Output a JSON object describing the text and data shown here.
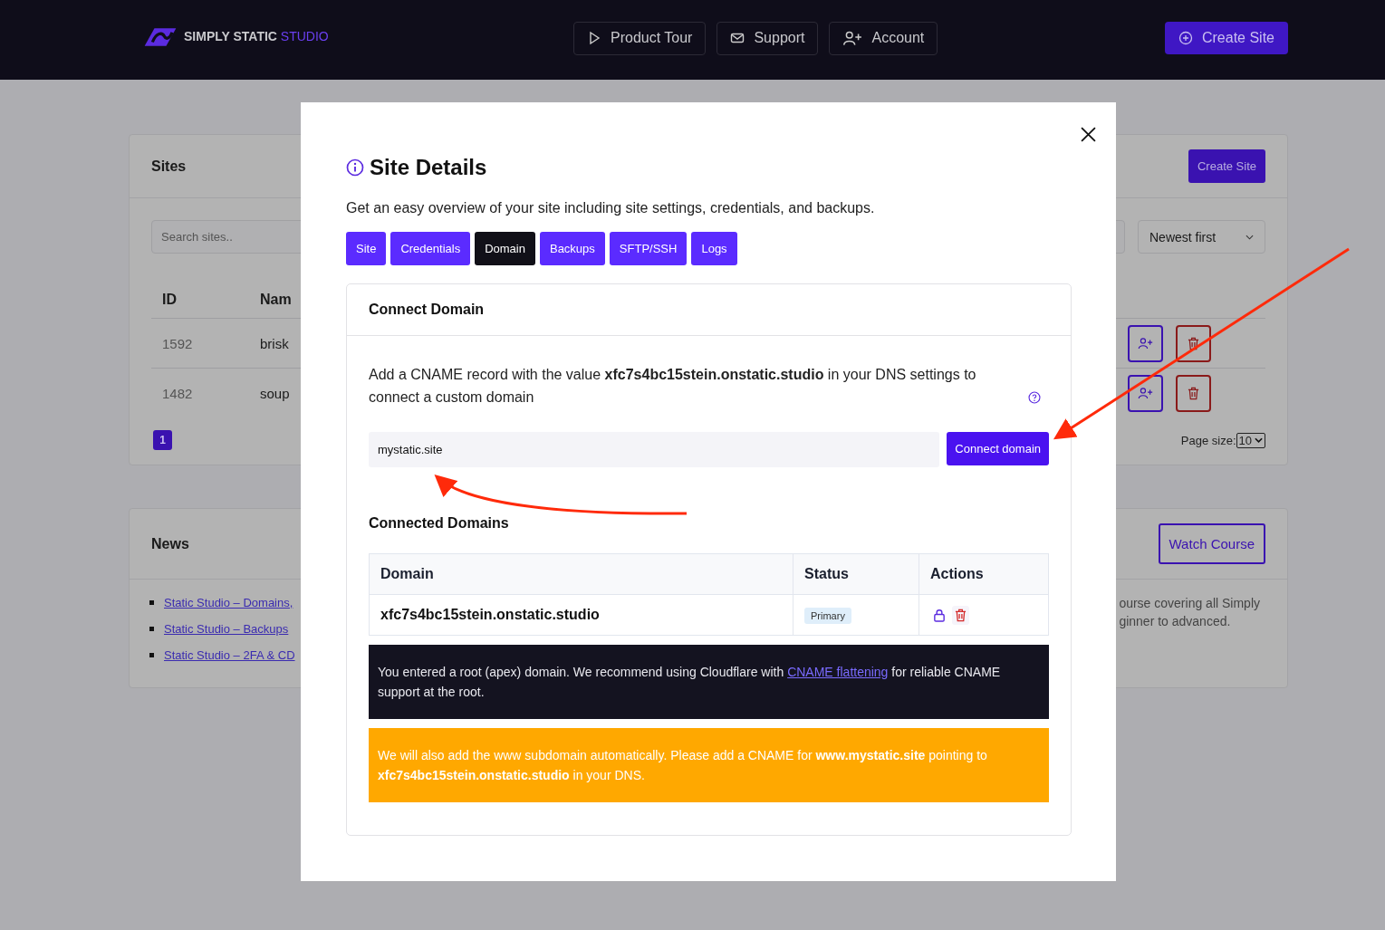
{
  "header": {
    "logo": {
      "main": "SIMPLY STATIC",
      "accent": "STUDIO"
    },
    "nav": [
      {
        "kind": "tour",
        "label": "Product Tour"
      },
      {
        "kind": "support",
        "label": "Support"
      },
      {
        "kind": "account",
        "label": "Account"
      }
    ],
    "create_button": "Create Site"
  },
  "sites_card": {
    "title": "Sites",
    "create_button": "Create Site",
    "search": {
      "placeholder": "Search sites.."
    },
    "sort": "Newest first",
    "columns": [
      "ID",
      "Nam"
    ],
    "rows": [
      {
        "id": "1592",
        "name": "brisk"
      },
      {
        "id": "1482",
        "name": "soup"
      }
    ],
    "pages": [
      {
        "label": "1",
        "selected": true
      }
    ],
    "page_size_label": "Page size:",
    "page_size": "10"
  },
  "news_card": {
    "title": "News",
    "links": [
      "Static Studio – Domains,",
      "Static Studio – Backups",
      "Static Studio – 2FA & CD"
    ],
    "watch_button": "Watch Course",
    "description": [
      "ourse covering all Simply",
      "ginner to advanced."
    ]
  },
  "modal": {
    "title": "Site Details",
    "description": "Get an easy overview of your site including site settings, credentials, and backups.",
    "tabs": [
      {
        "label": "Site",
        "selected": false
      },
      {
        "label": "Credentials",
        "selected": false
      },
      {
        "label": "Domain",
        "selected": true
      },
      {
        "label": "Backups",
        "selected": false
      },
      {
        "label": "SFTP/SSH",
        "selected": false
      },
      {
        "label": "Logs",
        "selected": false
      }
    ],
    "connect": {
      "title": "Connect Domain",
      "instruction": "Add a CNAME record with the value **xfc7s4bc15stein.onstatic.studio** in your DNS settings to connect a custom domain",
      "input": {
        "value": "mystatic.site"
      },
      "button": "Connect domain"
    },
    "connected_title": "Connected Domains",
    "table": {
      "columns": [
        "Domain",
        "Status",
        "Actions"
      ],
      "rows": [
        {
          "domain": "xfc7s4bc15stein.onstatic.studio",
          "status": "Primary"
        }
      ]
    },
    "notices": [
      {
        "kind": "dark",
        "before": "You entered a root (apex) domain. We recommend using Cloudflare with ",
        "link": "CNAME flattening",
        "after": " for reliable CNAME support at the root."
      },
      {
        "kind": "warning",
        "before": "We will also add the www subdomain automatically. Please add a CNAME for **www.mystatic.site** pointing to **xfc7s4bc15stein.onstatic.studio** in your DNS."
      }
    ]
  }
}
